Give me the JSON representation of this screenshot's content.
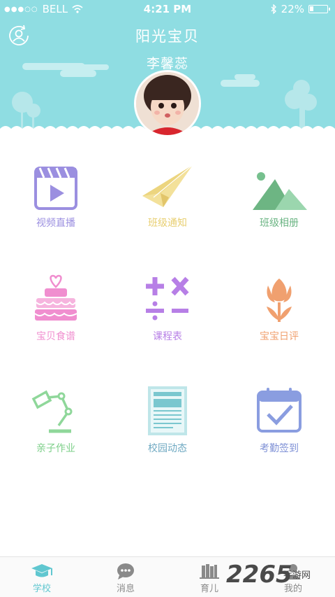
{
  "status_bar": {
    "carrier": "BELL",
    "time": "4:21 PM",
    "battery": "22%",
    "battery_level": 0.22
  },
  "header": {
    "title": "阳光宝贝",
    "child_name": "李馨蕊"
  },
  "features": [
    {
      "label": "视频直播",
      "icon": "video-play-icon",
      "color": "#9b8fe0"
    },
    {
      "label": "班级通知",
      "icon": "paper-plane-icon",
      "color": "#ecd57f"
    },
    {
      "label": "班级相册",
      "icon": "mountain-photo-icon",
      "color": "#76c08e"
    },
    {
      "label": "宝贝食谱",
      "icon": "cake-icon",
      "color": "#f08ecf"
    },
    {
      "label": "课程表",
      "icon": "math-symbols-icon",
      "color": "#b77fe6"
    },
    {
      "label": "宝宝日评",
      "icon": "tulip-icon",
      "color": "#f0a06f"
    },
    {
      "label": "亲子作业",
      "icon": "desk-lamp-icon",
      "color": "#8fd79a"
    },
    {
      "label": "校园动态",
      "icon": "newspaper-icon",
      "color": "#7ac7cf"
    },
    {
      "label": "考勤签到",
      "icon": "calendar-check-icon",
      "color": "#8a9de0"
    }
  ],
  "tabs": [
    {
      "label": "学校",
      "icon": "graduation-cap-icon",
      "active": true
    },
    {
      "label": "消息",
      "icon": "chat-bubble-icon",
      "active": false
    },
    {
      "label": "育儿",
      "icon": "books-icon",
      "active": false
    },
    {
      "label": "我的",
      "icon": "person-icon",
      "active": false
    }
  ],
  "watermark": {
    "number": "2265",
    "text": "手游网"
  }
}
